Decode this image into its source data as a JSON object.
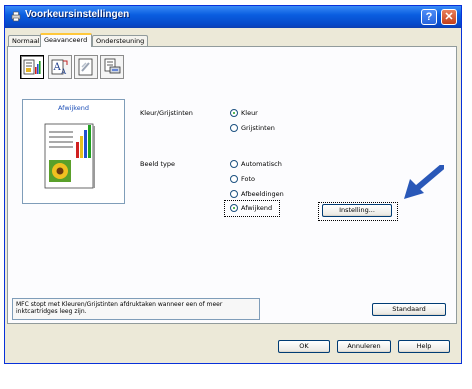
{
  "window": {
    "title": "Voorkeursinstellingen",
    "help_glyph": "?",
    "close_glyph": "✕"
  },
  "tabs": [
    {
      "label": "Normaal",
      "active": false
    },
    {
      "label": "Geavanceerd",
      "active": true
    },
    {
      "label": "Ondersteuning",
      "active": false
    }
  ],
  "toolbar_icons": [
    "color-quality-icon",
    "scaling-icon",
    "watermark-icon",
    "device-options-icon"
  ],
  "preview": {
    "title": "Afwijkend"
  },
  "color": {
    "label": "Kleur/Grijstinten",
    "options": [
      {
        "label": "Kleur",
        "selected": true
      },
      {
        "label": "Grijstinten",
        "selected": false
      }
    ]
  },
  "image_type": {
    "label": "Beeld type",
    "options": [
      {
        "label": "Automatisch",
        "selected": false
      },
      {
        "label": "Foto",
        "selected": false
      },
      {
        "label": "Afbeeldingen",
        "selected": false
      },
      {
        "label": "Afwijkend",
        "selected": true
      }
    ]
  },
  "setting_button": "Instelling...",
  "status_text": "MFC stopt met Kleuren/Grijstinten afdruktaken wanneer een of meer inktcartridges leeg zijn.",
  "default_button": "Standaard",
  "footer": {
    "ok": "OK",
    "cancel": "Annuleren",
    "help": "Help"
  },
  "colors": {
    "arrow": "#2a58b8",
    "title_bar": "#0a5ee0",
    "accent": "#1d4fb7"
  }
}
